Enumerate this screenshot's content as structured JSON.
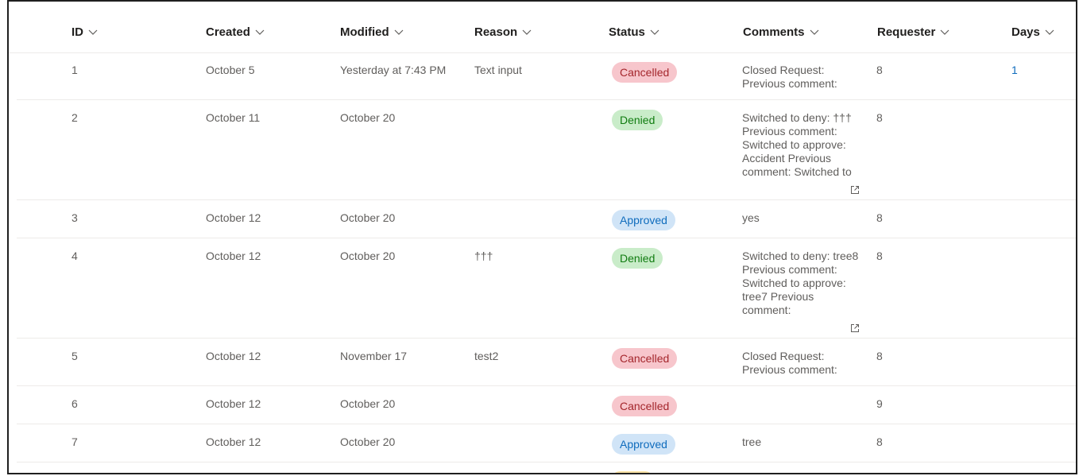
{
  "columns": [
    "ID",
    "Created",
    "Modified",
    "Reason",
    "Status",
    "Comments",
    "Requester",
    "Days"
  ],
  "rows": [
    {
      "id": "1",
      "created": "October 5",
      "modified": "Yesterday at 7:43 PM",
      "reason": "Text input",
      "status": "Cancelled",
      "comments": "Closed Request: Previous comment:",
      "requester": "8",
      "days": "1"
    },
    {
      "id": "2",
      "created": "October 11",
      "modified": "October 20",
      "reason": "",
      "status": "Denied",
      "comments": "Switched to deny: ††† Previous comment: Switched to approve: Accident Previous comment: Switched to approve:",
      "requester": "8",
      "days": ""
    },
    {
      "id": "3",
      "created": "October 12",
      "modified": "October 20",
      "reason": "",
      "status": "Approved",
      "comments": "yes",
      "requester": "8",
      "days": ""
    },
    {
      "id": "4",
      "created": "October 12",
      "modified": "October 20",
      "reason": "†††",
      "status": "Denied",
      "comments": "Switched to deny: tree8 Previous comment: Switched to approve: tree7 Previous comment:",
      "requester": "8",
      "days": ""
    },
    {
      "id": "5",
      "created": "October 12",
      "modified": "November 17",
      "reason": "test2",
      "status": "Cancelled",
      "comments": "Closed Request: Previous comment:",
      "requester": "8",
      "days": ""
    },
    {
      "id": "6",
      "created": "October 12",
      "modified": "October 20",
      "reason": "",
      "status": "Cancelled",
      "comments": "",
      "requester": "9",
      "days": ""
    },
    {
      "id": "7",
      "created": "October 12",
      "modified": "October 20",
      "reason": "",
      "status": "Approved",
      "comments": "tree",
      "requester": "8",
      "days": ""
    }
  ],
  "icons": {
    "sort": "chevron-down-icon",
    "expand": "open-in-new-window-icon"
  },
  "colors": {
    "cancelled_bg": "#f7c6cc",
    "denied_bg": "#c9ecc9",
    "approved_bg": "#d0e4f7",
    "link": "#0f6cbd"
  }
}
